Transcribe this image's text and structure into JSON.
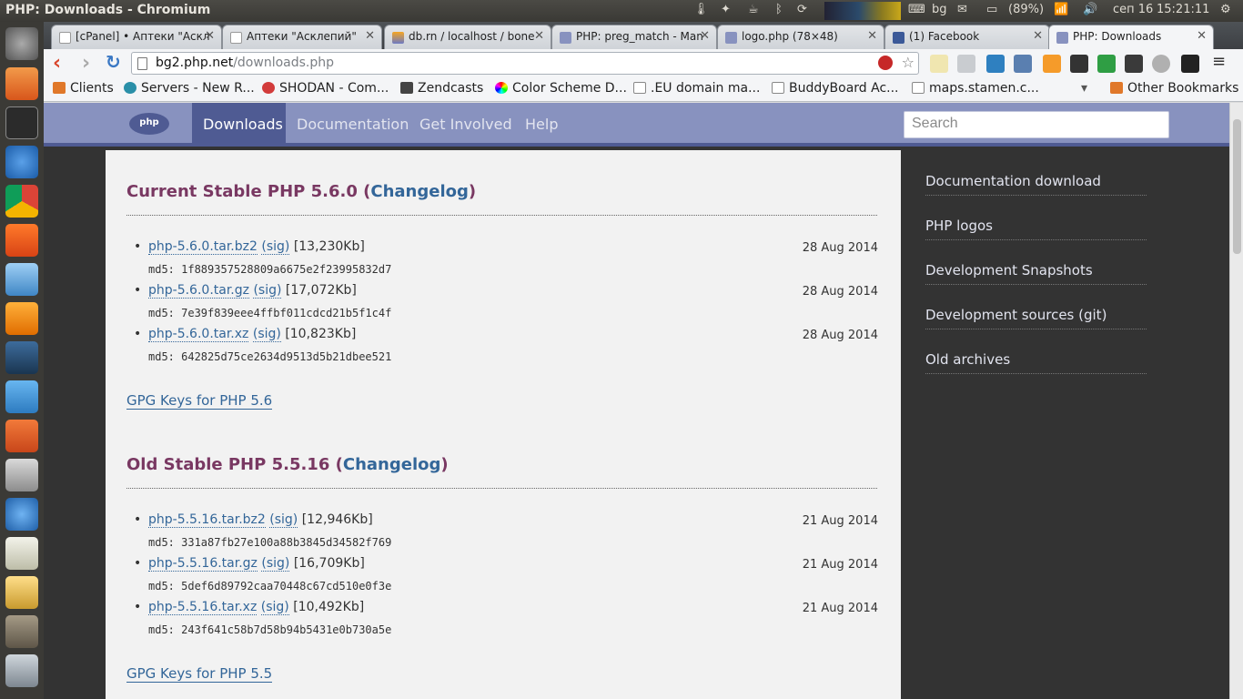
{
  "topbar": {
    "window_title": "PHP: Downloads - Chromium",
    "keyboard": "bg",
    "battery": "(89%)",
    "date": "сеп 16",
    "time": "15:21:11"
  },
  "tabs": [
    {
      "label": "[cPanel] • Аптеки \"Аскл"
    },
    {
      "label": "Аптеки \"Асклепий\""
    },
    {
      "label": "db.rn / localhost / bone"
    },
    {
      "label": "PHP: preg_match - Man"
    },
    {
      "label": "logo.php (78×48)"
    },
    {
      "label": "(1) Facebook"
    },
    {
      "label": "PHP: Downloads"
    }
  ],
  "omnibox": {
    "host": "bg2.php.net",
    "path": "/downloads.php"
  },
  "bookmarks": [
    {
      "label": "Clients"
    },
    {
      "label": "Servers - New R..."
    },
    {
      "label": "SHODAN - Com..."
    },
    {
      "label": "Zendcasts"
    },
    {
      "label": "Color Scheme D..."
    },
    {
      "label": ".EU domain ma..."
    },
    {
      "label": "BuddyBoard Ac..."
    },
    {
      "label": "maps.stamen.c..."
    },
    {
      "label": "Other Bookmarks"
    }
  ],
  "phpnav": {
    "logo": "php",
    "items": [
      {
        "label": "Downloads"
      },
      {
        "label": "Documentation"
      },
      {
        "label": "Get Involved"
      },
      {
        "label": "Help"
      }
    ],
    "search_placeholder": "Search"
  },
  "sections": [
    {
      "title": "Current Stable PHP 5.6.0 (",
      "changelog": "Changelog",
      "title_close": ")",
      "files": [
        {
          "name": "php-5.6.0.tar.bz2",
          "sig": "(sig)",
          "size": "[13,230Kb]",
          "date": "28 Aug 2014",
          "md5": "md5: 1f889357528809a6675e2f23995832d7"
        },
        {
          "name": "php-5.6.0.tar.gz",
          "sig": "(sig)",
          "size": "[17,072Kb]",
          "date": "28 Aug 2014",
          "md5": "md5: 7e39f839eee4ffbf011cdcd21b5f1c4f"
        },
        {
          "name": "php-5.6.0.tar.xz",
          "sig": "(sig)",
          "size": "[10,823Kb]",
          "date": "28 Aug 2014",
          "md5": "md5: 642825d75ce2634d9513d5b21dbee521"
        }
      ],
      "gpg": "GPG Keys for PHP 5.6"
    },
    {
      "title": "Old Stable PHP 5.5.16 (",
      "changelog": "Changelog",
      "title_close": ")",
      "files": [
        {
          "name": "php-5.5.16.tar.bz2",
          "sig": "(sig)",
          "size": "[12,946Kb]",
          "date": "21 Aug 2014",
          "md5": "md5: 331a87fb27e100a88b3845d34582f769"
        },
        {
          "name": "php-5.5.16.tar.gz",
          "sig": "(sig)",
          "size": "[16,709Kb]",
          "date": "21 Aug 2014",
          "md5": "md5: 5def6d89792caa70448c67cd510e0f3e"
        },
        {
          "name": "php-5.5.16.tar.xz",
          "sig": "(sig)",
          "size": "[10,492Kb]",
          "date": "21 Aug 2014",
          "md5": "md5: 243f641c58b7d58b94b5431e0b730a5e"
        }
      ],
      "gpg": "GPG Keys for PHP 5.5"
    }
  ],
  "sidebar": [
    {
      "label": "Documentation download"
    },
    {
      "label": "PHP logos"
    },
    {
      "label": "Development Snapshots"
    },
    {
      "label": "Development sources (git)"
    },
    {
      "label": "Old archives"
    }
  ],
  "colors": {
    "php_nav": "#8892bf",
    "php_nav_dark": "#4f5b93",
    "link": "#336699",
    "heading": "#793862"
  }
}
